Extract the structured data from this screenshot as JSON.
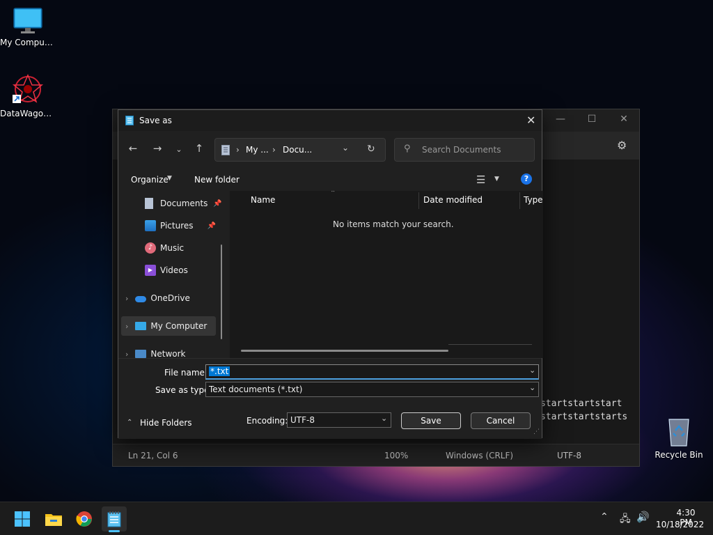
{
  "desktop": {
    "icons": [
      {
        "label": "My Computer"
      },
      {
        "label": "DataWagon..."
      },
      {
        "label": "Recycle Bin"
      }
    ]
  },
  "notepad": {
    "text_fragments": [
      "startstartstart",
      "startstartstarts"
    ],
    "status": {
      "position": "Ln 21, Col 6",
      "zoom": "100%",
      "line_ending": "Windows (CRLF)",
      "encoding": "UTF-8"
    }
  },
  "dialog": {
    "title": "Save as",
    "address": {
      "seg1": "My ...",
      "seg2": "Docu..."
    },
    "search_placeholder": "Search Documents",
    "toolbar": {
      "organize": "Organize",
      "new_folder": "New folder"
    },
    "nav": {
      "documents": "Documents",
      "pictures": "Pictures",
      "music": "Music",
      "videos": "Videos",
      "onedrive": "OneDrive",
      "my_computer": "My Computer",
      "network": "Network"
    },
    "columns": {
      "name": "Name",
      "date_modified": "Date modified",
      "type": "Type"
    },
    "empty_message": "No items match your search.",
    "file_name_label": "File name:",
    "file_name_value": "*.txt",
    "save_type_label": "Save as type:",
    "save_type_value": "Text documents (*.txt)",
    "hide_folders": "Hide Folders",
    "encoding_label": "Encoding:",
    "encoding_value": "UTF-8",
    "save": "Save",
    "cancel": "Cancel"
  },
  "taskbar": {
    "time": "4:30 PM",
    "date": "10/18/2022"
  },
  "colors": {
    "accent": "#0067c0",
    "selection": "#0078d4",
    "help": "#1a73e8"
  }
}
